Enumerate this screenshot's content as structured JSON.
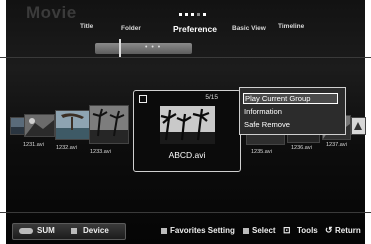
{
  "header": {
    "title": "Movie",
    "tabs": [
      "Title",
      "Folder",
      "Preference",
      "Basic View",
      "Timeline"
    ],
    "active_tab": "Preference"
  },
  "files": {
    "left": [
      "1231.avi",
      "1232.avi",
      "1233.avi"
    ],
    "right": [
      "1235.avi",
      "1236.avi",
      "1237.avi"
    ]
  },
  "focused": {
    "counter": "5/15",
    "filename": "ABCD.avi"
  },
  "menu": {
    "items": [
      "Play Current Group",
      "Information",
      "Safe Remove"
    ],
    "selected": "Play Current Group"
  },
  "footer": {
    "sum": "SUM",
    "device": "Device",
    "favorites": "Favorites Setting",
    "select": "Select",
    "tools": "Tools",
    "return": "Return"
  }
}
